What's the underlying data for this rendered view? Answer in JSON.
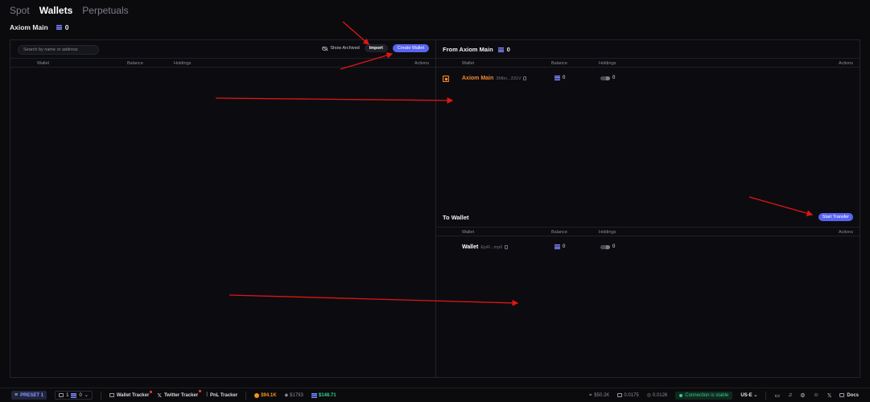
{
  "tabs": [
    {
      "label": "Spot",
      "active": false
    },
    {
      "label": "Wallets",
      "active": true
    },
    {
      "label": "Perpetuals",
      "active": false
    }
  ],
  "account": {
    "name": "Axiom Main",
    "balance": "0"
  },
  "left_panel": {
    "search_placeholder": "Search by name or address",
    "show_archived_label": "Show Archived",
    "import_label": "Import",
    "create_wallet_label": "Create Wallet",
    "columns": {
      "wallet": "Wallet",
      "balance": "Balance",
      "holdings": "Holdings",
      "actions": "Actions"
    }
  },
  "from_section": {
    "title": "From Axiom Main",
    "balance": "0",
    "columns": {
      "wallet": "Wallet",
      "balance": "Balance",
      "holdings": "Holdings",
      "actions": "Actions"
    },
    "rows": [
      {
        "name": "Axiom Main",
        "address": "3Mbn...331V",
        "balance": "0",
        "holdings": "0",
        "checked": true
      }
    ]
  },
  "to_section": {
    "title": "To Wallet",
    "start_transfer_label": "Start Transfer",
    "columns": {
      "wallet": "Wallet",
      "balance": "Balance",
      "holdings": "Holdings",
      "actions": "Actions"
    },
    "rows": [
      {
        "name": "Wallet",
        "address": "EjvR...mp6",
        "balance": "0",
        "holdings": "0"
      }
    ]
  },
  "bottom_bar": {
    "preset": "PRESET 1",
    "wallet_count": "1",
    "wallet_balance": "0",
    "wallet_tracker": "Wallet Tracker",
    "twitter_tracker": "Twitter Tracker",
    "pnl_tracker": "PnL Tracker",
    "btc_price": "$94.1K",
    "eth_price": "$1793",
    "sol_price": "$148.71",
    "market_cap": "$50.2K",
    "gas": "0.0175",
    "priority_fee": "0.0126",
    "connection_status": "Connection is stable",
    "region": "US-E",
    "docs_label": "Docs"
  },
  "colors": {
    "accent": "#5865f2",
    "orange": "#f28a2e",
    "green": "#2fd28a",
    "annotation_arrow": "#e01515"
  },
  "icons": [
    "solana-icon",
    "eye-off-icon",
    "copy-icon",
    "toggle-icon",
    "checkbox-icon",
    "bitcoin-icon",
    "ethereum-icon",
    "discord-icon",
    "x-icon",
    "docs-icon"
  ]
}
